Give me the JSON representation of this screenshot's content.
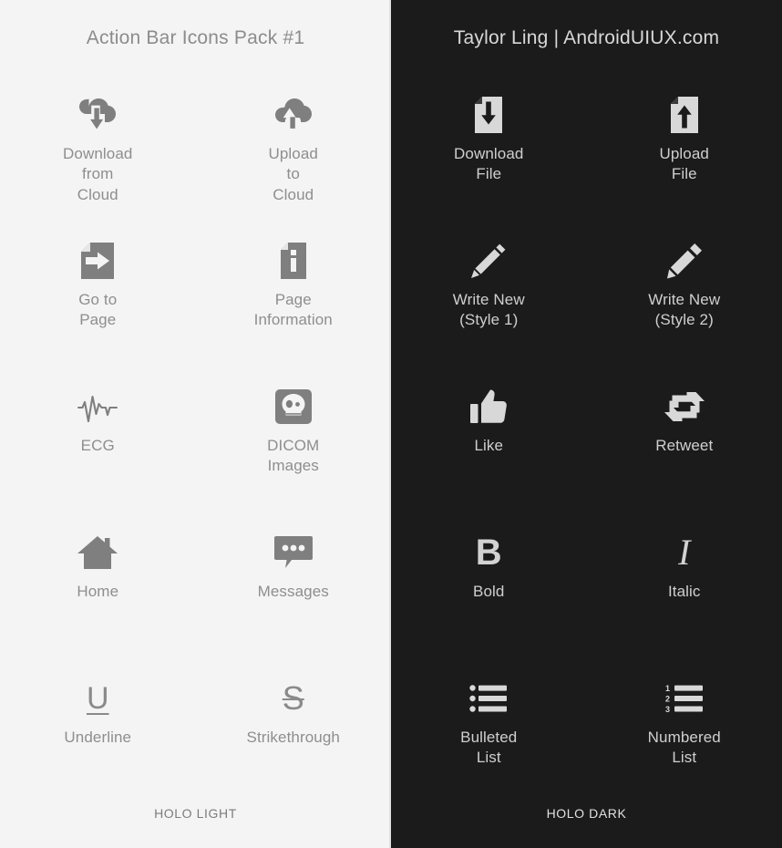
{
  "meta": {
    "light_bg": "#f4f4f4",
    "dark_bg": "#1b1b1b",
    "light_icon_color": "#7f7f7f",
    "dark_icon_color": "#d8d8d8"
  },
  "left_panel": {
    "title": "Action Bar Icons Pack #1",
    "footer": "HOLO LIGHT",
    "items": [
      {
        "icon": "cloud-download-icon",
        "label": "Download\nfrom\nCloud"
      },
      {
        "icon": "cloud-upload-icon",
        "label": "Upload\nto\nCloud"
      },
      {
        "icon": "go-to-page-icon",
        "label": "Go to\nPage"
      },
      {
        "icon": "page-info-icon",
        "label": "Page\nInformation"
      },
      {
        "icon": "ecg-icon",
        "label": "ECG"
      },
      {
        "icon": "dicom-skull-icon",
        "label": "DICOM\nImages"
      },
      {
        "icon": "home-icon",
        "label": "Home"
      },
      {
        "icon": "messages-icon",
        "label": "Messages"
      },
      {
        "icon": "underline-icon",
        "label": "Underline",
        "glyph": "U"
      },
      {
        "icon": "strikethrough-icon",
        "label": "Strikethrough",
        "glyph": "S"
      }
    ]
  },
  "right_panel": {
    "title": "Taylor Ling | AndroidUIUX.com",
    "footer": "HOLO DARK",
    "items": [
      {
        "icon": "file-download-icon",
        "label": "Download\nFile"
      },
      {
        "icon": "file-upload-icon",
        "label": "Upload\nFile"
      },
      {
        "icon": "pencil-style1-icon",
        "label": "Write New\n(Style 1)"
      },
      {
        "icon": "pencil-style2-icon",
        "label": "Write New\n(Style 2)"
      },
      {
        "icon": "thumbs-up-icon",
        "label": "Like"
      },
      {
        "icon": "retweet-icon",
        "label": "Retweet"
      },
      {
        "icon": "bold-icon",
        "label": "Bold",
        "glyph": "B"
      },
      {
        "icon": "italic-icon",
        "label": "Italic",
        "glyph": "I"
      },
      {
        "icon": "bulleted-list-icon",
        "label": "Bulleted\nList"
      },
      {
        "icon": "numbered-list-icon",
        "label": "Numbered\nList",
        "numbers": [
          "1",
          "2",
          "3"
        ]
      }
    ]
  }
}
